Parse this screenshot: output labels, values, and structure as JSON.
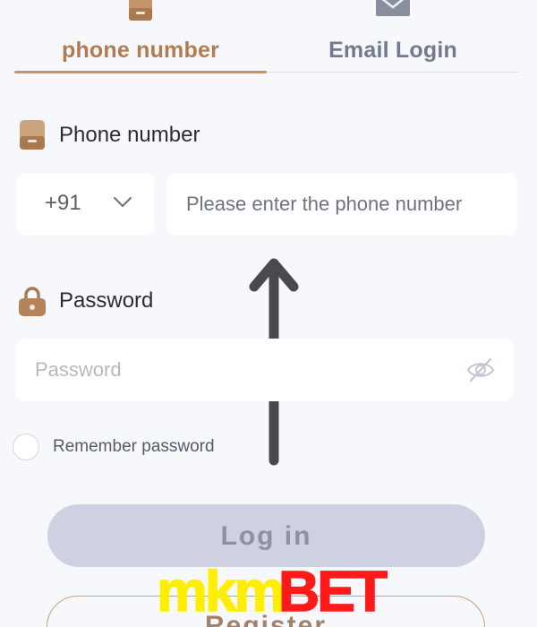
{
  "tabs": {
    "phone_label": "phone number",
    "email_label": "Email Login",
    "active": "phone number"
  },
  "phone_section": {
    "label": "Phone number",
    "country_code": "+91",
    "placeholder": "Please enter the phone number",
    "value": ""
  },
  "password_section": {
    "label": "Password",
    "placeholder": "Password",
    "value": ""
  },
  "remember": {
    "label": "Remember password",
    "checked": false
  },
  "buttons": {
    "login_label": "Log in",
    "register_label": "Register"
  },
  "watermark": {
    "text_part1": "mkm",
    "text_part2": "BET"
  },
  "icons": {
    "phone_tab": "phone-icon",
    "email_tab": "envelope-icon",
    "phone_label": "phone-icon",
    "password_label": "lock-icon",
    "country_chevron": "chevron-down-icon",
    "password_toggle": "eye-off-icon",
    "overlay_arrow": "arrow-up-icon"
  },
  "colors": {
    "accent": "#c49568",
    "accent_text": "#b07c52",
    "inactive_tab": "#727a8d",
    "login_bg": "#ced1e1",
    "login_text": "#8d91a0",
    "watermark_yellow": "#ffee00",
    "watermark_red": "#ff1a1a",
    "background": "#f7f8fc"
  }
}
